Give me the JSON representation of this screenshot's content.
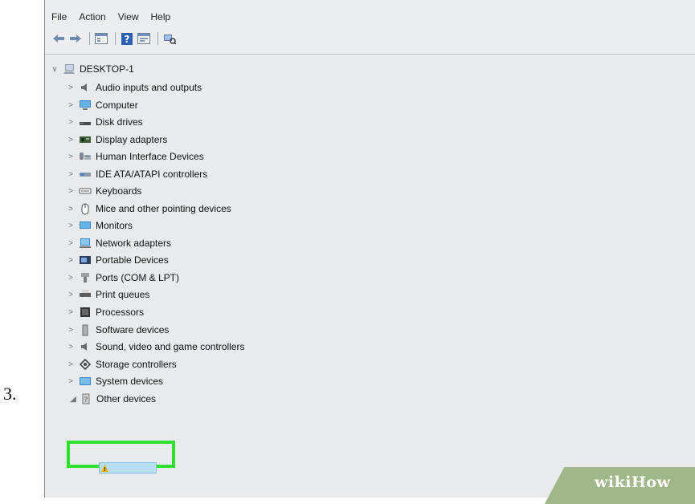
{
  "step_number": "3.",
  "menu": [
    {
      "label": "File"
    },
    {
      "label": "Action"
    },
    {
      "label": "View"
    },
    {
      "label": "Help"
    }
  ],
  "toolbar": [
    {
      "icon": "back-arrow-icon"
    },
    {
      "icon": "forward-arrow-icon"
    },
    {
      "icon": "console-tree-icon"
    },
    {
      "icon": "help-icon"
    },
    {
      "icon": "properties-icon"
    },
    {
      "icon": "scan-hardware-icon"
    }
  ],
  "tree": {
    "root": {
      "label": "DESKTOP-1",
      "icon": "computer-icon"
    },
    "categories": [
      {
        "label": "Audio inputs and outputs",
        "icon": "speaker-icon"
      },
      {
        "label": "Computer",
        "icon": "monitor-icon"
      },
      {
        "label": "Disk drives",
        "icon": "disk-drive-icon"
      },
      {
        "label": "Display adapters",
        "icon": "display-adapter-icon"
      },
      {
        "label": "Human Interface Devices",
        "icon": "hid-icon"
      },
      {
        "label": "IDE ATA/ATAPI controllers",
        "icon": "ide-controller-icon"
      },
      {
        "label": "Keyboards",
        "icon": "keyboard-icon"
      },
      {
        "label": "Mice and other pointing devices",
        "icon": "mouse-icon"
      },
      {
        "label": "Monitors",
        "icon": "monitor-icon"
      },
      {
        "label": "Network adapters",
        "icon": "network-adapter-icon"
      },
      {
        "label": "Portable Devices",
        "icon": "portable-device-icon"
      },
      {
        "label": "Ports (COM & LPT)",
        "icon": "port-icon"
      },
      {
        "label": "Print queues",
        "icon": "printer-icon"
      },
      {
        "label": "Processors",
        "icon": "processor-icon"
      },
      {
        "label": "Software devices",
        "icon": "software-device-icon"
      },
      {
        "label": "Sound, video and game controllers",
        "icon": "speaker-icon"
      },
      {
        "label": "Storage controllers",
        "icon": "storage-controller-icon"
      },
      {
        "label": "System devices",
        "icon": "system-device-icon"
      }
    ],
    "other_devices": {
      "label": "Other devices",
      "icon": "unknown-device-icon",
      "expanded": true,
      "child_icon": "warning-icon"
    }
  },
  "highlight_color": "#2ee02e",
  "watermark": {
    "wiki": "wiki",
    "how": "How"
  }
}
